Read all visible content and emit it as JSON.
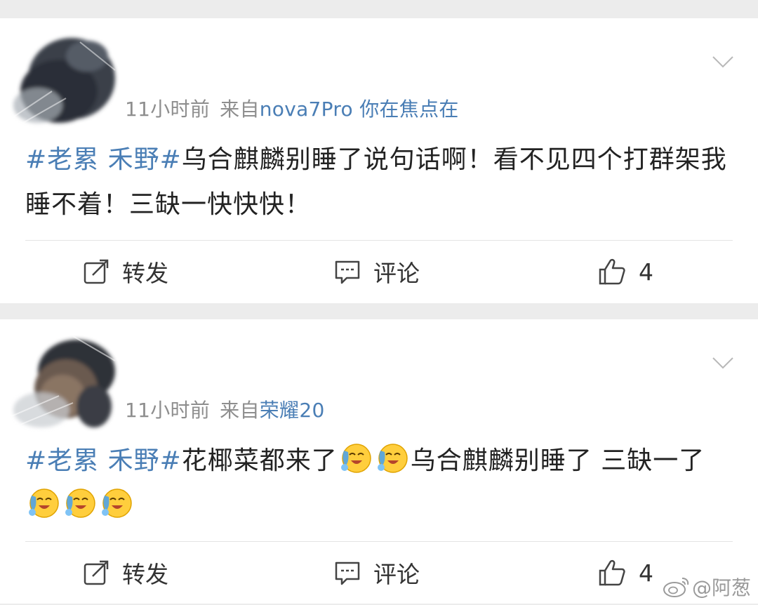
{
  "posts": [
    {
      "time": "11小时前",
      "source_prefix": "来自",
      "device": "nova7Pro 你在焦点在",
      "topic": "#老累 禾野#",
      "text": "乌合麒麟别睡了说句话啊！看不见四个打群架我睡不着！三缺一快快快！",
      "actions": {
        "repost": "转发",
        "comment": "评论",
        "likes": "4"
      }
    },
    {
      "time": "11小时前",
      "source_prefix": "来自",
      "device": "荣耀20",
      "topic": "#老累 禾野#",
      "text_a": "花椰菜都来了",
      "emoji_after_a": 2,
      "text_b": "乌合麒麟别睡了 三缺一了",
      "emoji_after_b": 3,
      "actions": {
        "repost": "转发",
        "comment": "评论",
        "likes": "4"
      }
    }
  ],
  "icons": {
    "avatar": "blurred-avatar",
    "chevron": "chevron-down-icon",
    "repost": "repost-icon",
    "comment": "comment-icon",
    "like": "thumbs-up-icon",
    "emoji": "crying-laughing-emoji",
    "watermark": "weibo-logo-icon"
  },
  "watermark": {
    "text": "@阿葱"
  },
  "colors": {
    "link": "#4a7eb5",
    "meta": "#8e8e8e",
    "background": "#ececec"
  }
}
